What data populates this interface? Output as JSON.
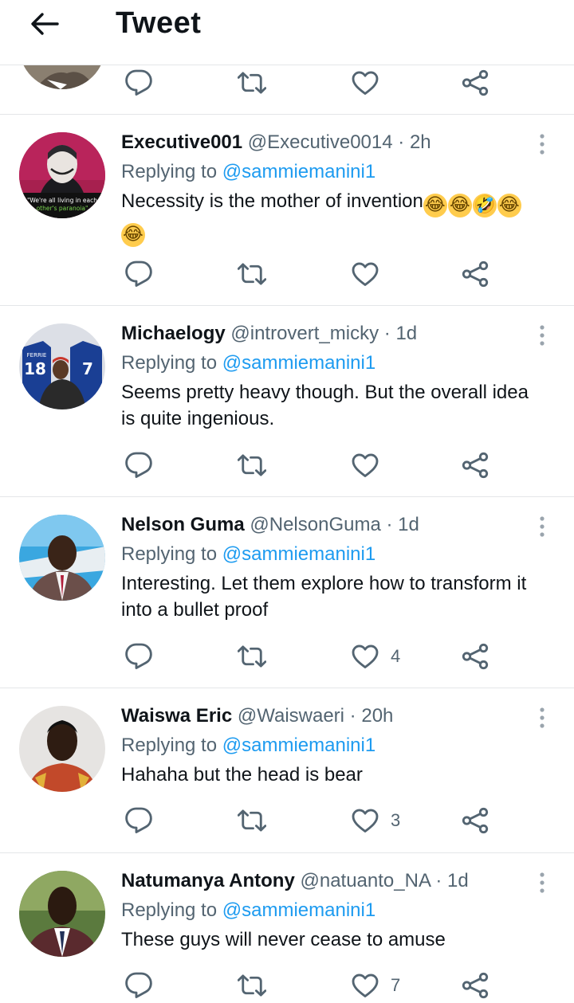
{
  "header": {
    "title": "Tweet"
  },
  "replies": [
    {
      "name": "Executive001",
      "handle": "@Executive0014",
      "sep": "·",
      "time": "2h",
      "replying_label": "Replying to",
      "mention": "@sammiemanini1",
      "text": "Necessity is the mother of invention",
      "emojis": [
        "😂",
        "😂",
        "🤣",
        "😂",
        "😂"
      ],
      "avatar_caption": [
        "\"We're all living in each",
        "other's paranoia\""
      ],
      "likes": ""
    },
    {
      "name": "Michaelogy",
      "handle": "@introvert_micky",
      "sep": "·",
      "time": "1d",
      "replying_label": "Replying to",
      "mention": "@sammiemanini1",
      "text": "Seems pretty heavy though. But the overall idea is quite ingenious.",
      "avatar_jersey": [
        "FERRIE",
        "18",
        "7"
      ],
      "likes": ""
    },
    {
      "name": "Nelson Guma",
      "handle": "@NelsonGuma",
      "sep": "·",
      "time": "1d",
      "replying_label": "Replying to",
      "mention": "@sammiemanini1",
      "text": "Interesting. Let them explore how to transform it into a bullet proof",
      "likes": "4"
    },
    {
      "name": "Waiswa Eric",
      "handle": "@Waiswaeri",
      "sep": "·",
      "time": "20h",
      "replying_label": "Replying to",
      "mention": "@sammiemanini1",
      "text": "Hahaha but the head is bear",
      "likes": "3"
    },
    {
      "name": "Natumanya Antony",
      "handle": "@natuanto_NA",
      "sep": "·",
      "time": "1d",
      "replying_label": "Replying to",
      "mention": "@sammiemanini1",
      "text": "These guys will never cease to amuse",
      "likes": "7"
    }
  ],
  "icons": {
    "back": "arrow-left-icon",
    "reply": "comment-icon",
    "retweet": "retweet-icon",
    "like": "heart-icon",
    "share": "share-icon",
    "more": "more-vertical-icon"
  },
  "colors": {
    "link": "#1d9bf0",
    "secondary_text": "#536471",
    "icon": "#536471",
    "divider": "#e4e6e8"
  }
}
